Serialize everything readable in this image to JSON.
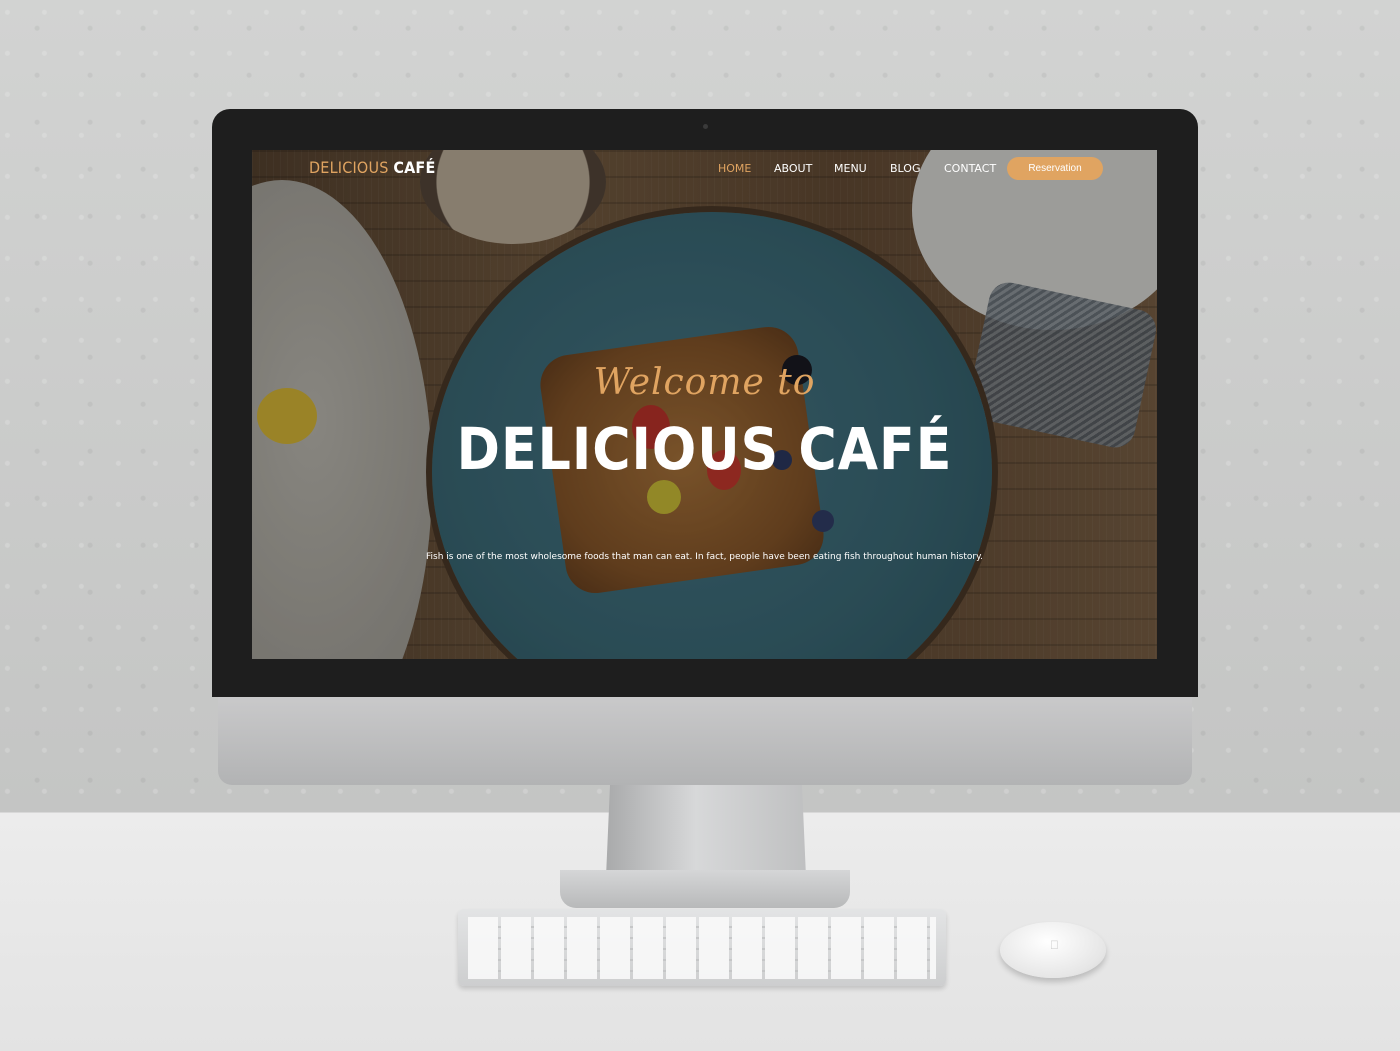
{
  "brand": {
    "logo_part1": "DELICIOUS",
    "logo_part2": "CAFÉ",
    "accent_color": "#e0a461"
  },
  "nav": {
    "items": [
      {
        "label": "HOME",
        "active": true
      },
      {
        "label": "ABOUT",
        "active": false
      },
      {
        "label": "MENU",
        "active": false
      },
      {
        "label": "BLOG",
        "active": false
      },
      {
        "label": "CONTACT",
        "active": false
      }
    ],
    "cta_label": "Reservation"
  },
  "hero": {
    "welcome": "Welcome to",
    "title": "DELICIOUS CAFÉ",
    "subtitle": "Fish is one of the most wholesome foods that man can eat. In fact, people have been eating fish throughout human history."
  },
  "icons": {
    "mouse_logo": "apple-icon"
  }
}
